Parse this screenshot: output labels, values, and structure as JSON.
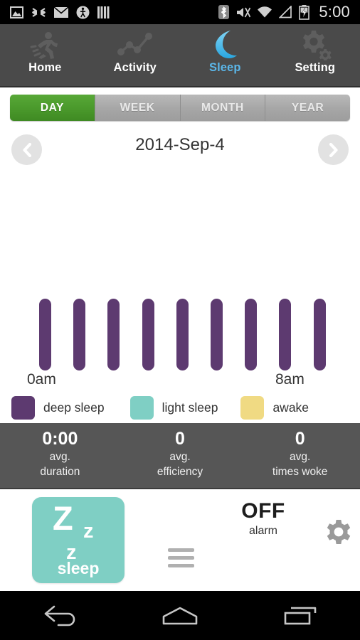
{
  "statusbar": {
    "time": "5:00",
    "left_icons": [
      "photo-icon",
      "shuffle-icon",
      "mail-icon",
      "pedestrian-icon",
      "bars-icon"
    ],
    "right_icons": [
      "bluetooth-icon",
      "mute-icon",
      "wifi-icon",
      "signal-icon",
      "battery-charging-icon"
    ]
  },
  "topnav": {
    "items": [
      {
        "label": "Home",
        "icon": "runner-icon",
        "active": false
      },
      {
        "label": "Activity",
        "icon": "chart-line-icon",
        "active": false
      },
      {
        "label": "Sleep",
        "icon": "moon-icon",
        "active": true
      },
      {
        "label": "Setting",
        "icon": "gear-icon",
        "active": false
      }
    ],
    "active_color": "#5bb6e8",
    "background": "#4a4a4a"
  },
  "period_tabs": {
    "items": [
      "DAY",
      "WEEK",
      "MONTH",
      "YEAR"
    ],
    "selected": "DAY",
    "active_color": "#4b9a2c"
  },
  "date_nav": {
    "date": "2014-Sep-4",
    "prev_icon": "chevron-left-icon",
    "next_icon": "chevron-right-icon"
  },
  "chart_data": {
    "type": "bar",
    "title": "",
    "xlabel": "",
    "ylabel": "",
    "x_tick_labels": [
      "0am",
      "8am"
    ],
    "grid": false,
    "legend_position": "bottom",
    "series": [
      {
        "name": "deep sleep",
        "color": "#5d3a70",
        "values": [
          1,
          1,
          1,
          1,
          1,
          1,
          1,
          1,
          1
        ]
      }
    ],
    "legend": [
      {
        "label": "deep sleep",
        "color": "#5d3a70"
      },
      {
        "label": "light sleep",
        "color": "#7fcfc4"
      },
      {
        "label": "awake",
        "color": "#f0da83"
      }
    ],
    "bar_count": 9,
    "bar_color": "#5d3a70"
  },
  "stats": {
    "items": [
      {
        "value": "0:00",
        "line1": "avg.",
        "line2": "duration"
      },
      {
        "value": "0",
        "line1": "avg.",
        "line2": "efficiency"
      },
      {
        "value": "0",
        "line1": "avg.",
        "line2": "times woke"
      }
    ],
    "background": "#565656"
  },
  "controls": {
    "sleep_button": {
      "z_big": "Z",
      "z_mid": "z",
      "z_small": "z",
      "label": "sleep",
      "color": "#7fcfc4"
    },
    "menu_icon": "hamburger-icon",
    "alarm": {
      "value": "OFF",
      "label": "alarm"
    },
    "settings_icon": "gear-icon"
  },
  "android_nav": {
    "buttons": [
      "back-icon",
      "home-icon",
      "recents-icon"
    ]
  }
}
